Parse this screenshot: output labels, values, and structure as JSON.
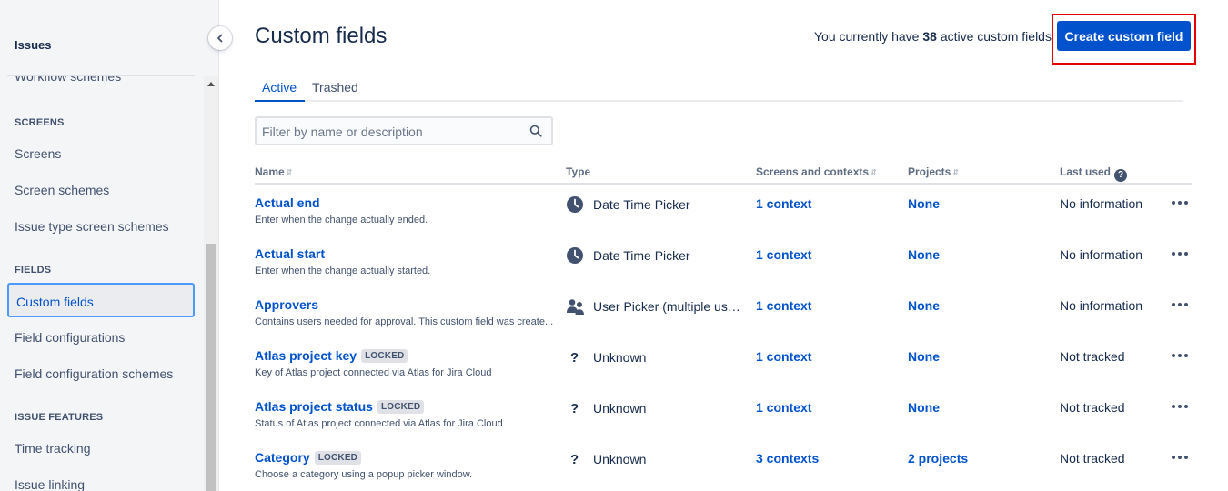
{
  "sidebar": {
    "header": "Issues",
    "cut_item": "Workflow schemes",
    "sections": {
      "screens": "SCREENS",
      "fields": "FIELDS",
      "issue_features": "ISSUE FEATURES"
    },
    "items": {
      "screens": "Screens",
      "screen_schemes": "Screen schemes",
      "issue_type_screen_schemes": "Issue type screen schemes",
      "custom_fields": "Custom fields",
      "field_configurations": "Field configurations",
      "field_configuration_schemes": "Field configuration schemes",
      "time_tracking": "Time tracking",
      "issue_linking": "Issue linking"
    },
    "selected": "custom_fields"
  },
  "header": {
    "title": "Custom fields",
    "count_prefix": "You currently have",
    "count": "38",
    "count_suffix": "active custom fields",
    "create_button": "Create custom field",
    "accent_color": "#0052cc",
    "highlight_color": "#e60000"
  },
  "tabs": {
    "active": "Active",
    "trashed": "Trashed"
  },
  "filter": {
    "placeholder": "Filter by name or description",
    "value": ""
  },
  "table": {
    "columns": {
      "name": "Name",
      "type": "Type",
      "screens": "Screens and contexts",
      "projects": "Projects",
      "last_used": "Last used"
    },
    "rows": [
      {
        "name": "Actual end",
        "locked": "",
        "description": "Enter when the change actually ended.",
        "type": "Date Time Picker",
        "type_icon": "clock-icon",
        "contexts": "1 context",
        "projects": "None",
        "last_used": "No information"
      },
      {
        "name": "Actual start",
        "locked": "",
        "description": "Enter when the change actually started.",
        "type": "Date Time Picker",
        "type_icon": "clock-icon",
        "contexts": "1 context",
        "projects": "None",
        "last_used": "No information"
      },
      {
        "name": "Approvers",
        "locked": "",
        "description": "Contains users needed for approval. This custom field was create...",
        "type": "User Picker (multiple users)",
        "type_icon": "people-icon",
        "contexts": "1 context",
        "projects": "None",
        "last_used": "No information"
      },
      {
        "name": "Atlas project key",
        "locked": "LOCKED",
        "description": "Key of Atlas project connected via Atlas for Jira Cloud",
        "type": "Unknown",
        "type_icon": "question-icon",
        "contexts": "1 context",
        "projects": "None",
        "last_used": "Not tracked"
      },
      {
        "name": "Atlas project status",
        "locked": "LOCKED",
        "description": "Status of Atlas project connected via Atlas for Jira Cloud",
        "type": "Unknown",
        "type_icon": "question-icon",
        "contexts": "1 context",
        "projects": "None",
        "last_used": "Not tracked"
      },
      {
        "name": "Category",
        "locked": "LOCKED",
        "description": "Choose a category using a popup picker window.",
        "type": "Unknown",
        "type_icon": "question-icon",
        "contexts": "3 contexts",
        "projects": "2 projects",
        "last_used": "Not tracked"
      }
    ]
  }
}
